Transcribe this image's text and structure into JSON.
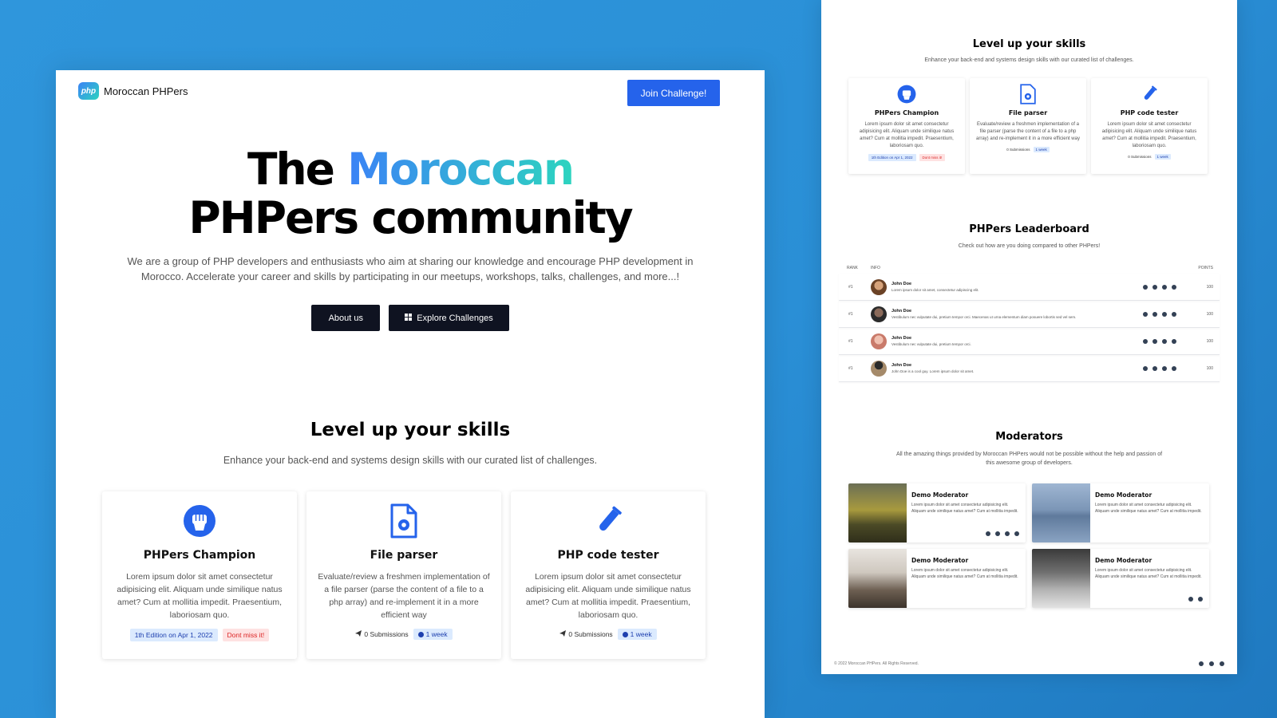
{
  "main": {
    "nav": {
      "logo_badge": "php",
      "brand": "Moroccan PHPers",
      "join_label": "Join Challenge!",
      "theme_icon": "moon-icon"
    },
    "hero": {
      "title_part1": "The ",
      "title_accent": "Moroccan",
      "title_part2": " PHPers community",
      "description": "We are a group of PHP developers and enthusiasts who aim at sharing our knowledge and encourage PHP development in Morocco. Accelerate your career and skills by participating in our meetups, workshops, talks, challenges, and more...!",
      "about_label": "About us",
      "explore_label": "Explore Challenges",
      "accent_gradient": [
        "#3b82f6",
        "#2dd4bf"
      ]
    },
    "skills": {
      "title": "Level up your skills",
      "subtitle": "Enhance your back-end and systems design skills with our curated list of challenges.",
      "cards": [
        {
          "icon": "fist-icon",
          "title": "PHPers Champion",
          "description": "Lorem ipsum dolor sit amet consectetur adipisicing elit. Aliquam unde similique natus amet? Cum at mollitia impedit. Praesentium, laboriosam quo.",
          "tag1": "1th Edition on Apr 1, 2022",
          "tag2": "Dont miss it!"
        },
        {
          "icon": "file-gear-icon",
          "title": "File parser",
          "description": "Evaluate/review a freshmen implementation of a file parser (parse the content of a file to a php array) and re-implement it in a more efficient way",
          "submissions": "0 Submissions",
          "duration": "1 week"
        },
        {
          "icon": "test-tube-icon",
          "title": "PHP code tester",
          "description": "Lorem ipsum dolor sit amet consectetur adipisicing elit. Aliquam unde similique natus amet? Cum at mollitia impedit. Praesentium, laboriosam quo.",
          "submissions": "0 Submissions",
          "duration": "1 week"
        }
      ]
    }
  },
  "side": {
    "skills": {
      "title": "Level up your skills",
      "subtitle": "Enhance your back-end and systems design skills with our curated list of challenges.",
      "cards": [
        {
          "title": "PHPers Champion",
          "description": "Lorem ipsum dolor sit amet consectetur adipisicing elit. Aliquam unde similique natus amet? Cum at mollitia impedit. Praesentium, laboriosam quo.",
          "tag1": "1th Edition on Apr 1, 2022",
          "tag2": "Dont miss it!"
        },
        {
          "title": "File parser",
          "description": "Evaluate/review a freshmen implementation of a file parser (parse the content of a file to a php array) and re-implement it in a more efficient way",
          "submissions": "0 Submissions",
          "duration": "1 week"
        },
        {
          "title": "PHP code tester",
          "description": "Lorem ipsum dolor sit amet consectetur adipisicing elit. Aliquam unde similique natus amet? Cum at mollitia impedit. Praesentium, laboriosam quo.",
          "submissions": "0 Submissions",
          "duration": "1 week"
        }
      ]
    },
    "leaderboard": {
      "title": "PHPers Leaderboard",
      "subtitle": "Check out how are you doing compared to other PHPers!",
      "columns": {
        "rank": "RANK",
        "info": "INFO",
        "points": "POINTS"
      },
      "rows": [
        {
          "rank": "#1",
          "name": "John Doe",
          "bio": "Lorem ipsum dolor sit amet, consectetur adipiscing elit.",
          "points": "100"
        },
        {
          "rank": "#1",
          "name": "John Doe",
          "bio": "Vestibulum nec vulputate dui, pretium tempor orci. Maecenas ut urna elementum diam posuere lobortis sed vel sem.",
          "points": "100"
        },
        {
          "rank": "#1",
          "name": "John Doe",
          "bio": "Vestibulum nec vulputate dui, pretium tempor orci.",
          "points": "100"
        },
        {
          "rank": "#1",
          "name": "John Doe",
          "bio": "John Doe is a cool guy. Lorem ipsum dolor sit amet.",
          "points": "100"
        }
      ]
    },
    "moderators": {
      "title": "Moderators",
      "subtitle": "All the amazing things provided by Moroccan PHPers would not be possible without the help and passion of this awesome group of developers.",
      "items": [
        {
          "name": "Demo Moderator",
          "bio": "Lorem ipsum dolor sit amet consectetur adipisicing elit. Aliquam unde similique natus amet? Cum at mollitia impedit."
        },
        {
          "name": "Demo Moderator",
          "bio": "Lorem ipsum dolor sit amet consectetur adipisicing elit. Aliquam unde similique natus amet? Cum at mollitia impedit."
        },
        {
          "name": "Demo Moderator",
          "bio": "Lorem ipsum dolor sit amet consectetur adipisicing elit. Aliquam unde similique natus amet? Cum at mollitia impedit."
        },
        {
          "name": "Demo Moderator",
          "bio": "Lorem ipsum dolor sit amet consectetur adipisicing elit. Aliquam unde similique natus amet? Cum at mollitia impedit."
        }
      ]
    },
    "footer": {
      "copyright": "© 2022 Moroccan PHPers. All Rights Reserved."
    }
  },
  "colors": {
    "background": "#2a8fd6",
    "primary_button": "#2563eb",
    "dark_button": "#0f1321",
    "icon_blue": "#2563eb"
  }
}
